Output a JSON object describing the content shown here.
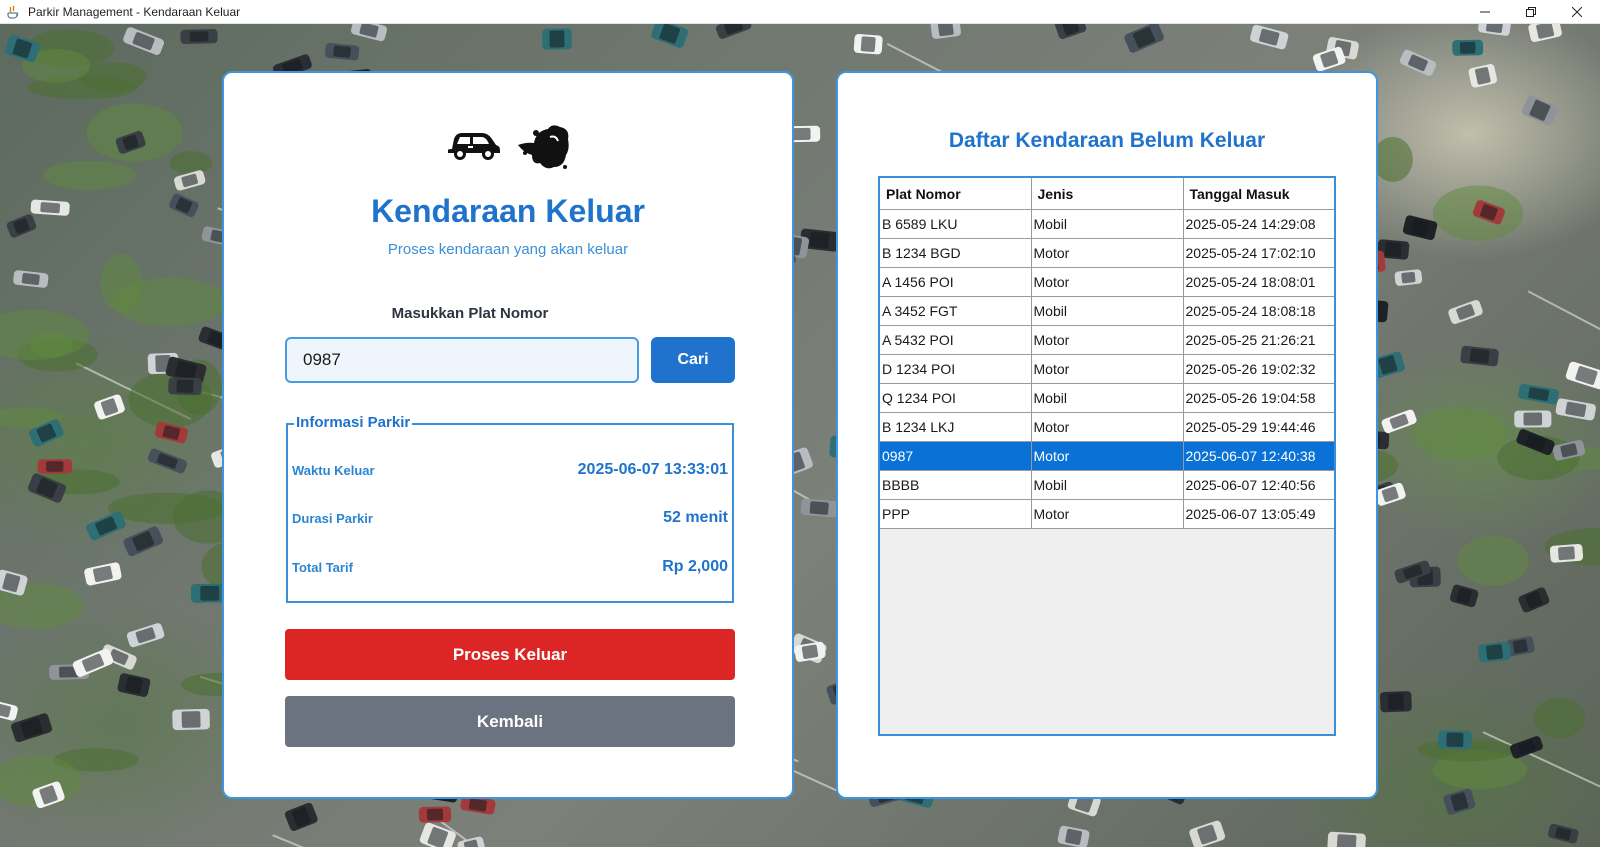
{
  "window": {
    "title": "Parkir Management - Kendaraan Keluar"
  },
  "left_panel": {
    "title": "Kendaraan Keluar",
    "subtitle": "Proses kendaraan yang akan keluar",
    "plate_label": "Masukkan Plat Nomor",
    "plate_input_value": "0987",
    "search_button": "Cari",
    "info": {
      "legend": "Informasi Parkir",
      "rows": [
        {
          "label": "Waktu Keluar",
          "value": "2025-06-07 13:33:01"
        },
        {
          "label": "Durasi Parkir",
          "value": "52 menit"
        },
        {
          "label": "Total Tarif",
          "value": "Rp 2,000"
        }
      ]
    },
    "process_button": "Proses Keluar",
    "back_button": "Kembali",
    "icons": [
      "car-icon",
      "exhaust-smoke-icon"
    ]
  },
  "right_panel": {
    "title": "Daftar Kendaraan Belum Keluar",
    "columns": [
      "Plat Nomor",
      "Jenis",
      "Tanggal Masuk"
    ],
    "rows": [
      [
        "B 6589 LKU",
        "Mobil",
        "2025-05-24 14:29:08"
      ],
      [
        "B 1234 BGD",
        "Motor",
        "2025-05-24 17:02:10"
      ],
      [
        "A 1456 POI",
        "Motor",
        "2025-05-24 18:08:01"
      ],
      [
        "A 3452 FGT",
        "Mobil",
        "2025-05-24 18:08:18"
      ],
      [
        "A 5432 POI",
        "Motor",
        "2025-05-25 21:26:21"
      ],
      [
        "D 1234 POI",
        "Motor",
        "2025-05-26 19:02:32"
      ],
      [
        "Q 1234 POI",
        "Mobil",
        "2025-05-26 19:04:58"
      ],
      [
        "B 1234 LKJ",
        "Motor",
        "2025-05-29 19:44:46"
      ],
      [
        "0987",
        "Motor",
        "2025-06-07 12:40:38"
      ],
      [
        "BBBB",
        "Mobil",
        "2025-06-07 12:40:56"
      ],
      [
        "PPP",
        "Motor",
        "2025-06-07 13:05:49"
      ]
    ],
    "selected_row": 8
  },
  "colors": {
    "accent": "#1f73cc",
    "process": "#dc2626",
    "back": "#6b7280",
    "selection": "#0a72d6"
  }
}
